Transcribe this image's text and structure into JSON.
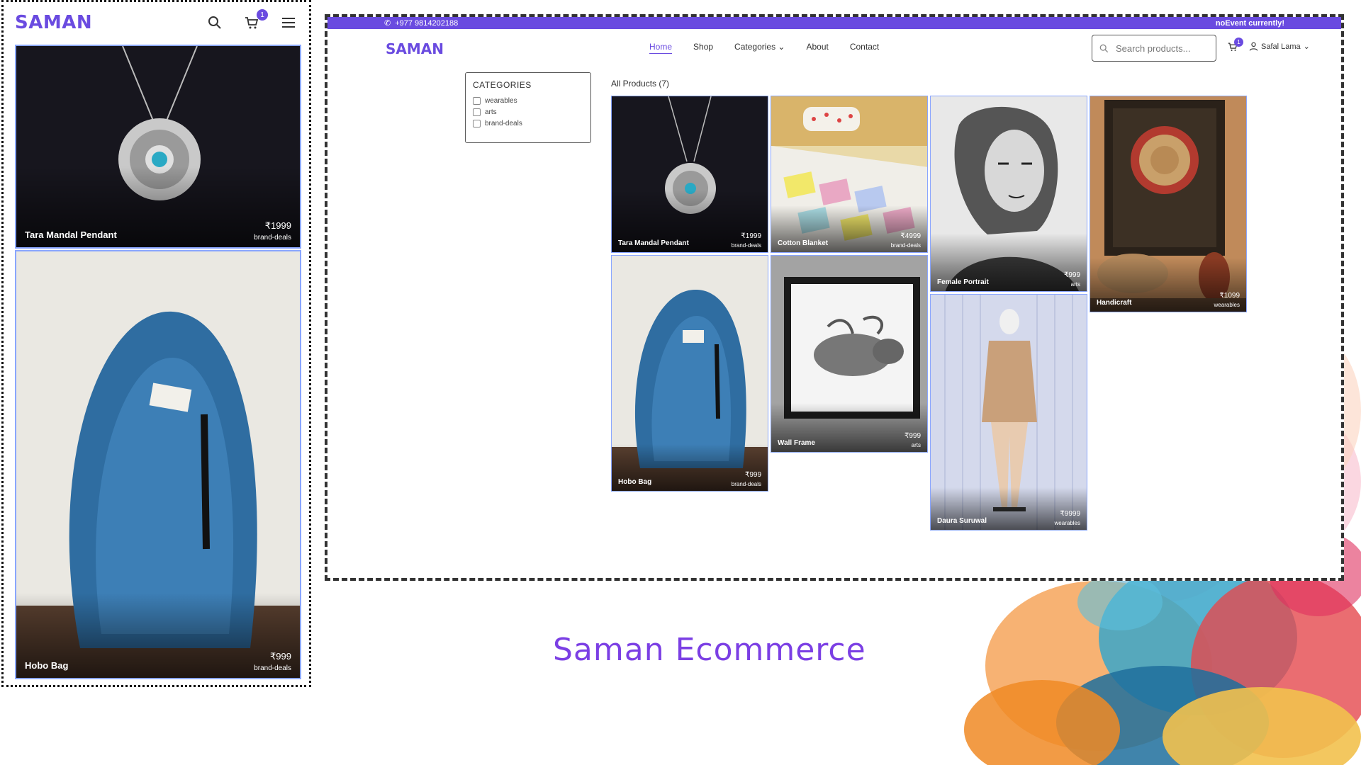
{
  "colors": {
    "accent": "#6a4be0",
    "card_border": "#8aa6ff",
    "caption": "#7b3fe4"
  },
  "mobile": {
    "logo": "SAMAN",
    "icons": [
      "search-icon",
      "cart-icon",
      "menu-icon"
    ],
    "cart_count": "1",
    "products": [
      {
        "name": "Tara Mandal Pendant",
        "price": "₹1999",
        "category": "brand-deals"
      },
      {
        "name": "Hobo Bag",
        "price": "₹999",
        "category": "brand-deals"
      }
    ]
  },
  "desktop": {
    "topbar": {
      "phone": "+977 9814202188",
      "event": "noEvent currently!"
    },
    "logo": "SAMAN",
    "nav": {
      "home": "Home",
      "shop": "Shop",
      "categories": "Categories",
      "about": "About",
      "contact": "Contact"
    },
    "search_placeholder": "Search products...",
    "cart_count": "1",
    "user_name": "Safal Lama",
    "categories_title": "CATEGORIES",
    "categories": [
      "wearables",
      "arts",
      "brand-deals"
    ],
    "all_products": "All Products (7)",
    "products": [
      {
        "name": "Tara Mandal Pendant",
        "price": "₹1999",
        "category": "brand-deals"
      },
      {
        "name": "Cotton Blanket",
        "price": "₹4999",
        "category": "brand-deals"
      },
      {
        "name": "Female Portrait",
        "price": "₹999",
        "category": "arts"
      },
      {
        "name": "Handicraft",
        "price": "₹1099",
        "category": "wearables"
      },
      {
        "name": "Hobo Bag",
        "price": "₹999",
        "category": "brand-deals"
      },
      {
        "name": "Wall Frame",
        "price": "₹999",
        "category": "arts"
      },
      {
        "name": "Daura Suruwal",
        "price": "₹9999",
        "category": "wearables"
      }
    ]
  },
  "caption": "Saman Ecommerce"
}
